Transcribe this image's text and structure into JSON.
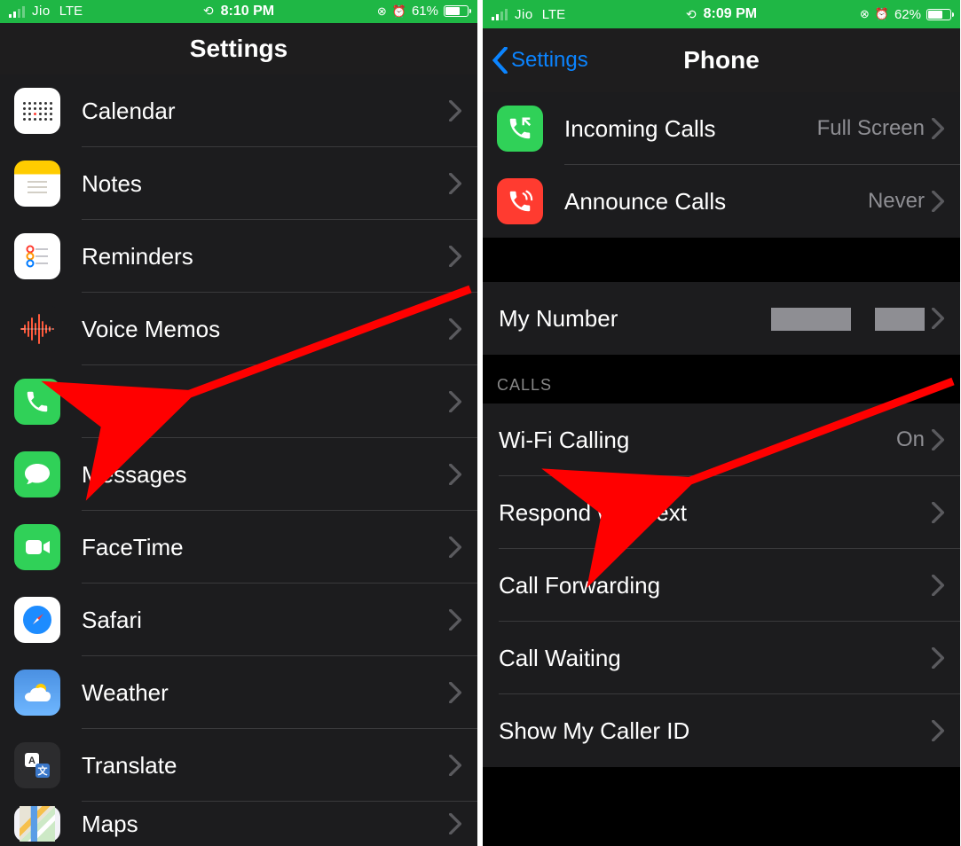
{
  "left": {
    "status": {
      "carrier": "Jio",
      "network": "LTE",
      "time": "8:10 PM",
      "battery_pct": "61%"
    },
    "header": {
      "title": "Settings"
    },
    "rows": [
      {
        "label": "Calendar"
      },
      {
        "label": "Notes"
      },
      {
        "label": "Reminders"
      },
      {
        "label": "Voice Memos"
      },
      {
        "label": "Phone"
      },
      {
        "label": "Messages"
      },
      {
        "label": "FaceTime"
      },
      {
        "label": "Safari"
      },
      {
        "label": "Weather"
      },
      {
        "label": "Translate"
      },
      {
        "label": "Maps"
      }
    ]
  },
  "right": {
    "status": {
      "carrier": "Jio",
      "network": "LTE",
      "time": "8:09 PM",
      "battery_pct": "62%"
    },
    "header": {
      "back": "Settings",
      "title": "Phone"
    },
    "top_rows": [
      {
        "label": "Incoming Calls",
        "value": "Full Screen"
      },
      {
        "label": "Announce Calls",
        "value": "Never"
      }
    ],
    "my_number": {
      "label": "My Number"
    },
    "section": "CALLS",
    "call_rows": [
      {
        "label": "Wi-Fi Calling",
        "value": "On"
      },
      {
        "label": "Respond with Text"
      },
      {
        "label": "Call Forwarding"
      },
      {
        "label": "Call Waiting"
      },
      {
        "label": "Show My Caller ID"
      }
    ]
  }
}
